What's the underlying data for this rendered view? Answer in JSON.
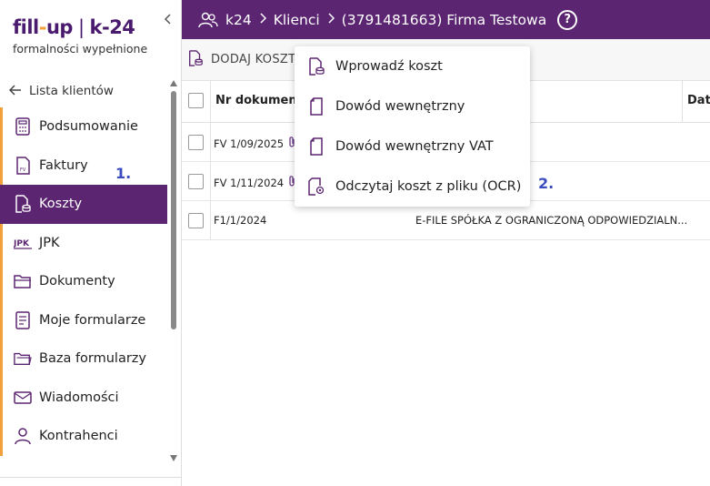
{
  "logo": {
    "brand_left": "fill",
    "brand_dash": "-",
    "brand_up": "up",
    "brand_right": "k-24",
    "tagline": "formalności wypełnione"
  },
  "sidebar": {
    "back_label": "Lista klientów",
    "items": [
      {
        "label": "Podsumowanie",
        "icon": "calculator-icon"
      },
      {
        "label": "Faktury",
        "icon": "invoice-icon"
      },
      {
        "label": "Koszty",
        "icon": "costs-icon",
        "active": true
      },
      {
        "label": "JPK",
        "icon": "jpk-icon"
      },
      {
        "label": "Dokumenty",
        "icon": "folder-icon"
      },
      {
        "label": "Moje formularze",
        "icon": "form-icon"
      },
      {
        "label": "Baza formularzy",
        "icon": "folders-icon"
      },
      {
        "label": "Wiadomości",
        "icon": "mail-icon"
      },
      {
        "label": "Kontrahenci",
        "icon": "person-icon"
      }
    ]
  },
  "header": {
    "crumb_root": "k24",
    "crumb_clients": "Klienci",
    "crumb_company": "(3791481663) Firma Testowa",
    "help": "?"
  },
  "toolbar": {
    "add_cost_label": "DODAJ KOSZT"
  },
  "table": {
    "col_nr": "Nr dokument",
    "col_data": "Data",
    "rows": [
      {
        "doc": "FV 1/09/2025",
        "attachment": true,
        "name": ""
      },
      {
        "doc": "FV 1/11/2024",
        "attachment": true,
        "name": ""
      },
      {
        "doc": "F1/1/2024",
        "attachment": false,
        "name": "E-FILE SPÓŁKA Z OGRANICZONĄ ODPOWIEDZIALN..."
      }
    ]
  },
  "menu": {
    "items": [
      {
        "label": "Wprowadź koszt",
        "icon": "cost-entry-icon"
      },
      {
        "label": "Dowód wewnętrzny",
        "icon": "document-icon"
      },
      {
        "label": "Dowód wewnętrzny VAT",
        "icon": "document-vat-icon"
      },
      {
        "label": "Odczytaj koszt z pliku (OCR)",
        "icon": "ocr-icon"
      }
    ]
  },
  "annotations": {
    "step1": "1.",
    "step2": "2."
  },
  "colors": {
    "primary_purple": "#5b2571",
    "accent_orange": "#f2a03a",
    "annotation_blue": "#3b4cc0"
  }
}
